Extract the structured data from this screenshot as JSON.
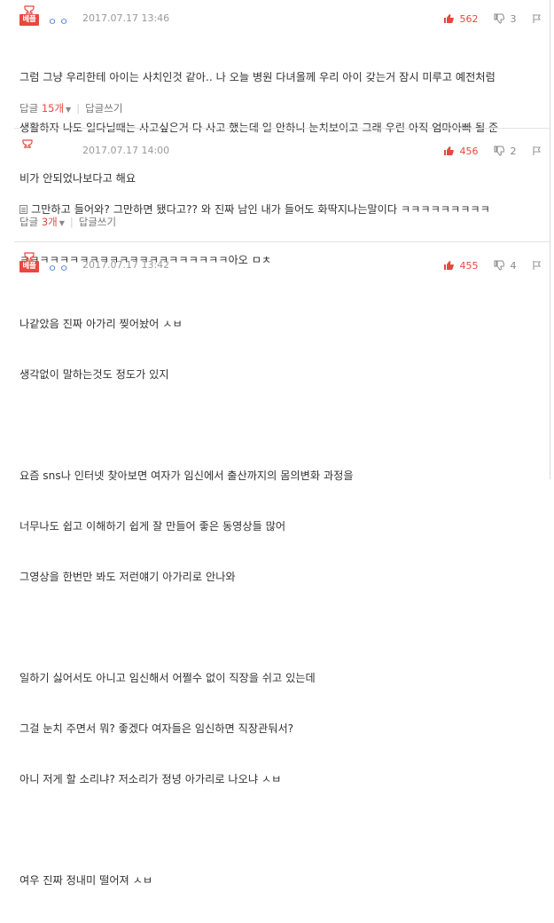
{
  "comments": [
    {
      "badge": "베플",
      "dots": "ㅇㅇ",
      "date": "2017.07.17 13:46",
      "up": "562",
      "down": "3",
      "lines": [
        "그럼 그냥 우리한테 아이는 사치인것 같아.. 나 오늘 병원 다녀올께 우리 아이 갖는거 잠시 미루고 예전처럼",
        "생활하자 나도 일다닐때는 사고싶은거 다 사고 했는데 일 안하니 눈치보이고 그래 우린 아직 엄마아빠 될 준",
        "비가 안되었나보다고 해요"
      ],
      "reply_label": "답글",
      "reply_count": "15개",
      "write_label": "답글쓰기"
    },
    {
      "dots": "",
      "date": "2017.07.17 14:00",
      "up": "456",
      "down": "2",
      "lines": [
        "그만하고 들어와? 그만하면 됐다고?? 와 진짜 남인 내가 들어도 화딱지나는말이다 ㅋㅋㅋㅋㅋㅋㅋㅋㅋ",
        "ㅋㅋㅋㅋㅋㅋㅋㅋㅋㅋㅋㅋㅋㅋㅋㅋㅋㅋㅋㅋㅋ아오 ㅁㅊ"
      ],
      "reply_label": "답글",
      "reply_count": "3개",
      "write_label": "답글쓰기"
    },
    {
      "badge": "베플",
      "dots": "ㅇㅇ",
      "date": "2017.07.17 13:42",
      "up": "455",
      "down": "4",
      "lines": [
        "나같았음 진짜 아가리 찢어놨어 ㅅㅂ",
        "생각없이 말하는것도 정도가 있지",
        "",
        "요즘 sns나 인터넷 찾아보면 여자가 임신에서 출산까지의 몸의변화 과정을",
        "너무나도 쉽고 이해하기 쉽게 잘 만들어 좋은 동영상들 많어",
        "그영상을 한번만 봐도 저런얘기 아가리로 안나와",
        "",
        "일하기 싫어서도 아니고 임신해서 어쩔수 없이 직장을 쉬고 있는데",
        "그걸 눈치 주면서 뭐? 좋겠다 여자들은 임신하면 직장관둬서?",
        "아니 저게 할 소리냐? 저소리가 정녕 아가리로 나오냐 ㅅㅂ",
        "",
        "여우 진짜 정내미 떨어져 ㅅㅂ"
      ]
    }
  ],
  "colors": {
    "accent": "#e5493f",
    "dots": "#4a7dd3"
  }
}
